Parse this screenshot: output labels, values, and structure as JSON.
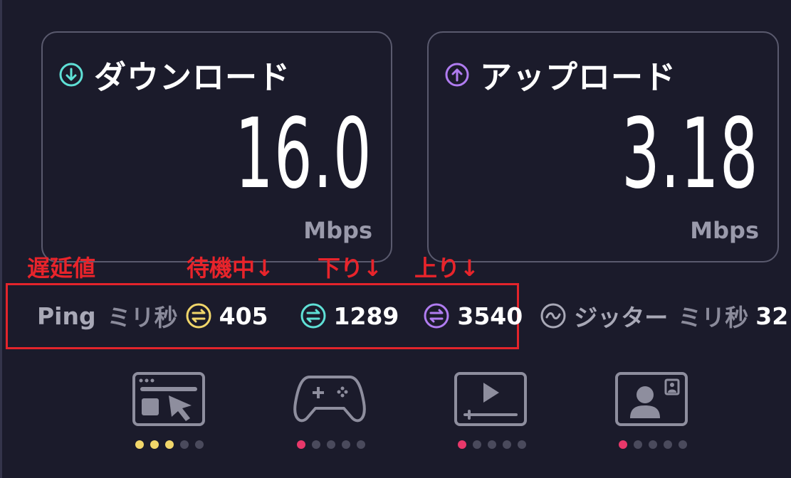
{
  "download": {
    "title": "ダウンロード",
    "value": "16.0",
    "unit": "Mbps",
    "icon": "arrow-down-circle-icon",
    "accent": "#5fe0d6"
  },
  "upload": {
    "title": "アップロード",
    "value": "3.18",
    "unit": "Mbps",
    "icon": "arrow-up-circle-icon",
    "accent": "#b07cf0"
  },
  "annotations": {
    "latency": "遅延値",
    "idle": "待機中↓",
    "down": "下り↓",
    "up": "上り↓",
    "color": "#e3242b"
  },
  "ping": {
    "label": "Ping",
    "unit": "ミリ秒",
    "idle": {
      "value": "405",
      "color": "#f1d66a"
    },
    "down": {
      "value": "1289",
      "color": "#5fe0d6"
    },
    "up": {
      "value": "3540",
      "color": "#b07cf0"
    }
  },
  "jitter": {
    "label": "ジッター",
    "unit": "ミリ秒",
    "value": "32"
  },
  "use_cases": [
    {
      "icon": "web-browsing-icon",
      "rating": 3,
      "color": "#f1d66a"
    },
    {
      "icon": "gaming-controller-icon",
      "rating": 1,
      "color": "#e8386a"
    },
    {
      "icon": "video-streaming-icon",
      "rating": 1,
      "color": "#e8386a"
    },
    {
      "icon": "video-call-icon",
      "rating": 1,
      "color": "#e8386a"
    }
  ]
}
